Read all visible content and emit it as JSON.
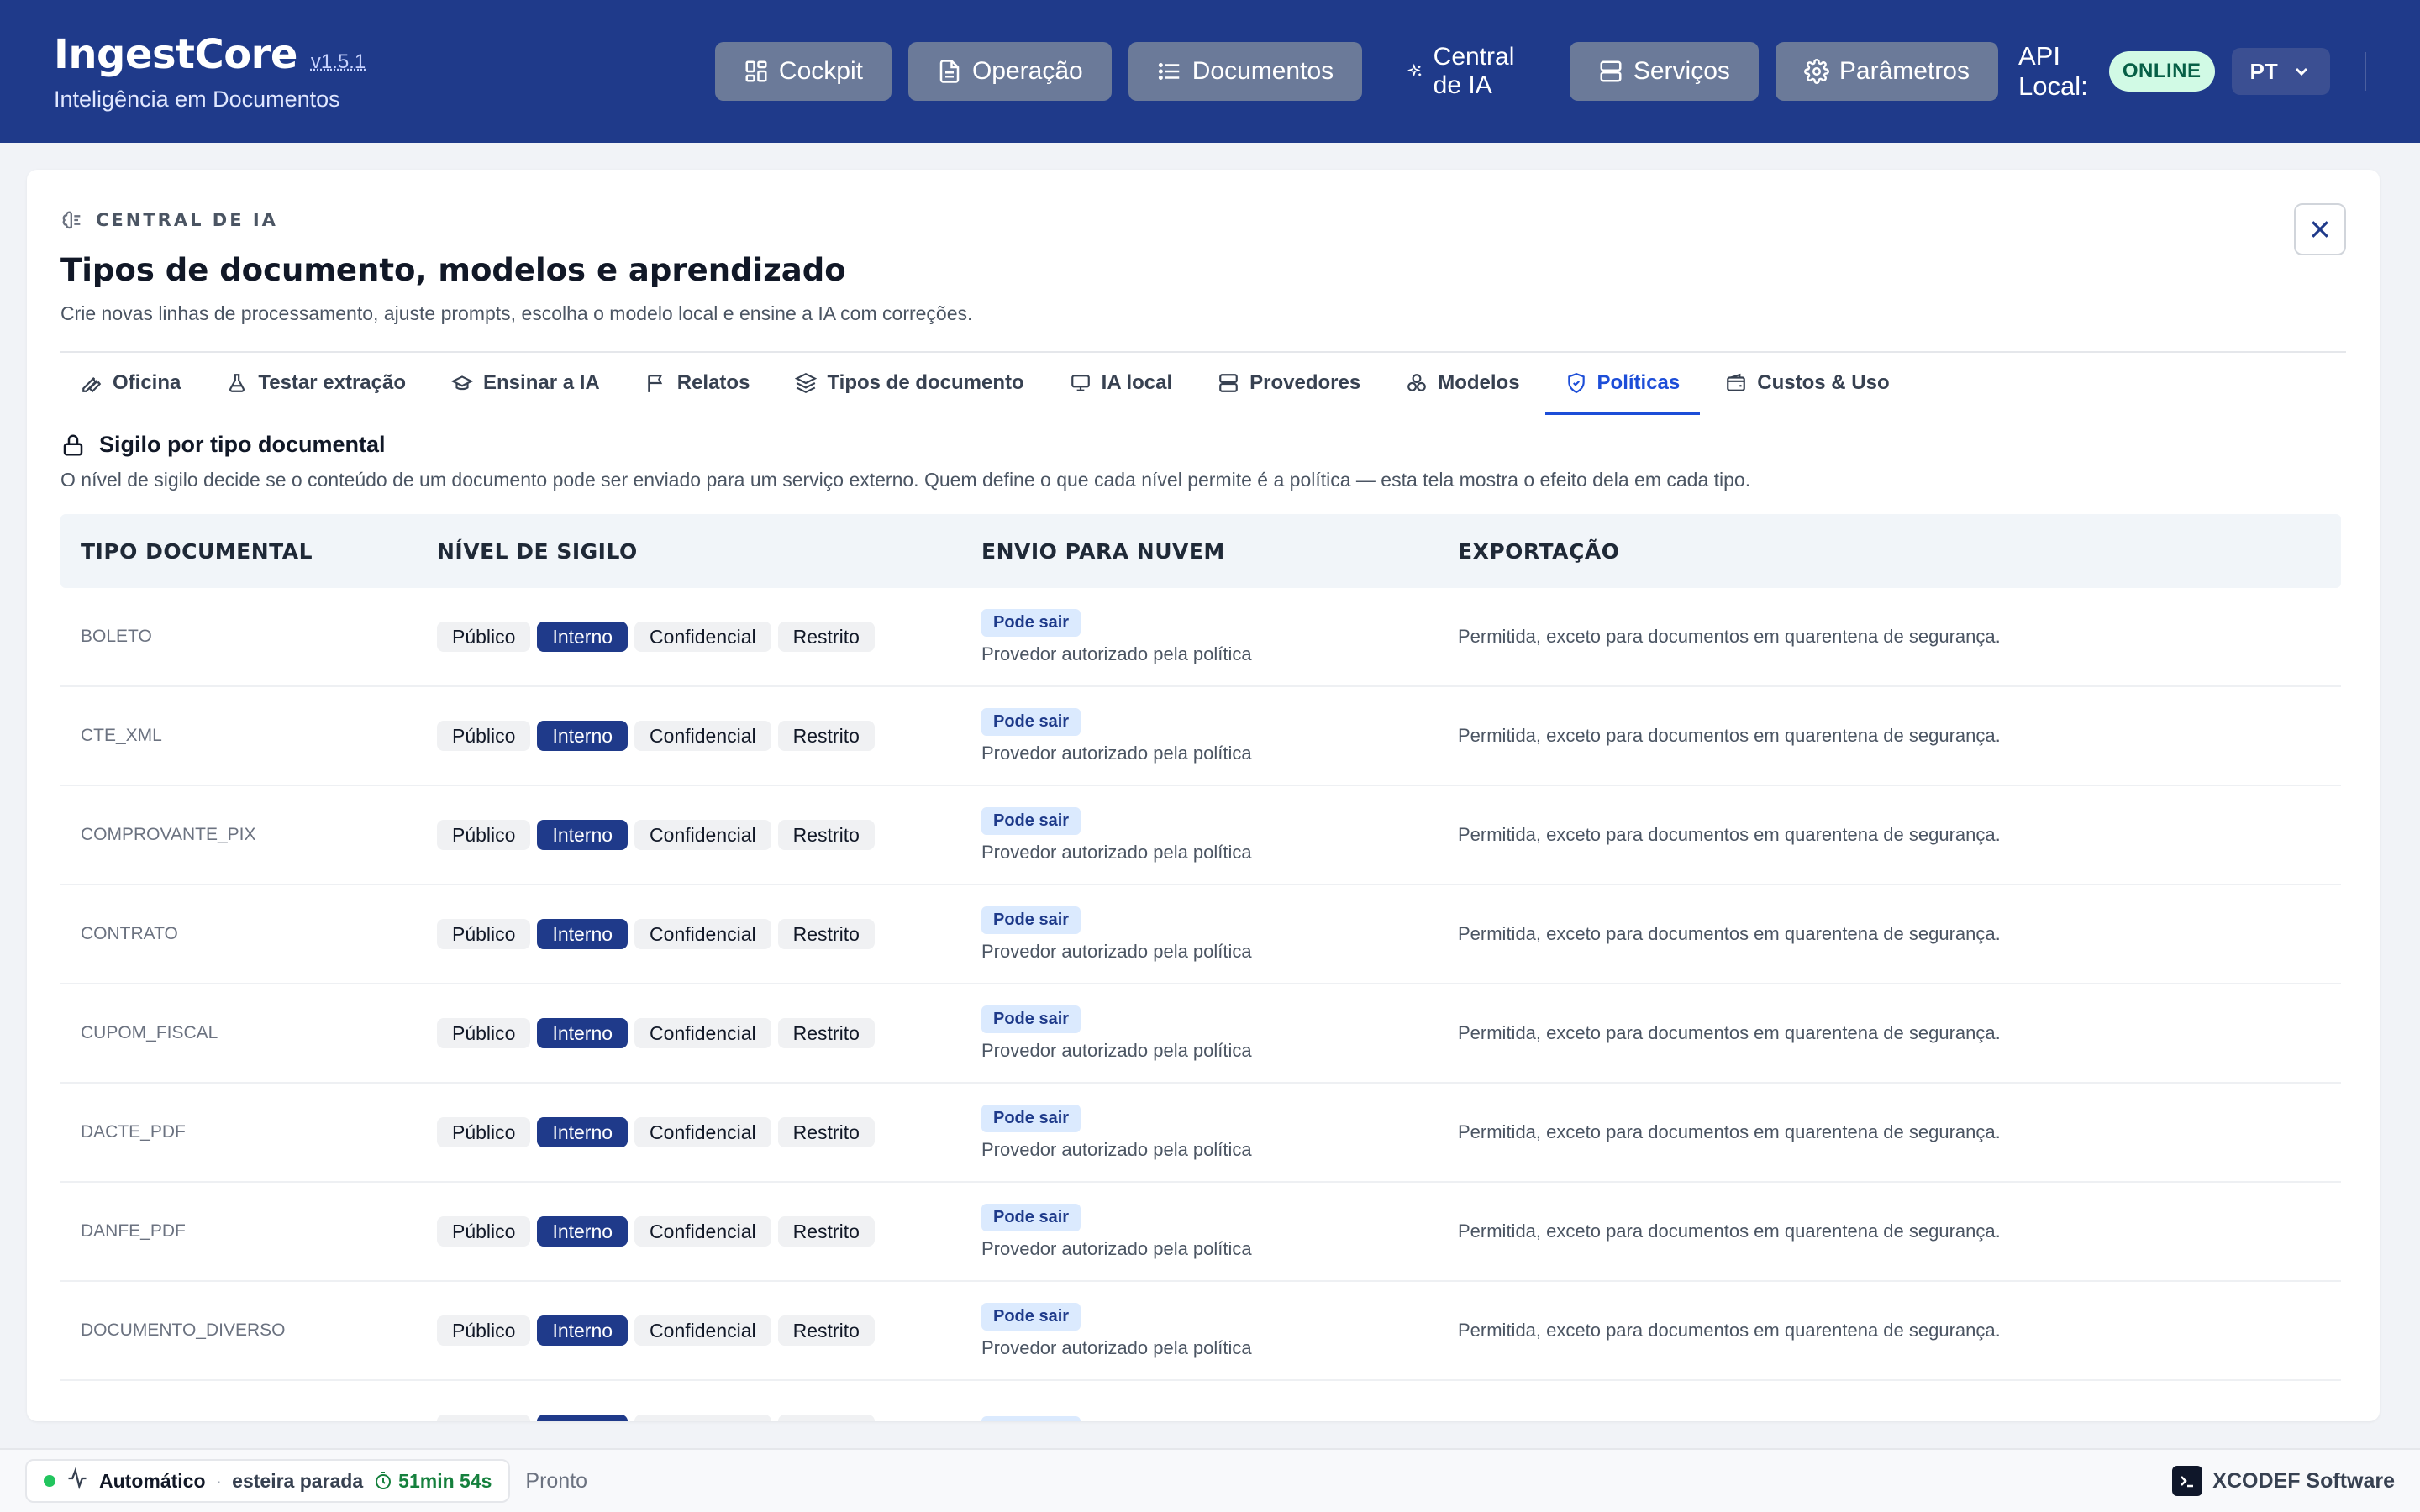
{
  "app": {
    "name": "IngestCore",
    "version": "v1.5.1",
    "subtitle": "Inteligência em Documentos"
  },
  "nav": [
    {
      "label": "Cockpit",
      "icon": "grid-icon"
    },
    {
      "label": "Operação",
      "icon": "document-icon"
    },
    {
      "label": "Documentos",
      "icon": "list-icon"
    },
    {
      "label": "Central de IA",
      "icon": "sparkles-icon"
    },
    {
      "label": "Serviços",
      "icon": "server-icon"
    },
    {
      "label": "Parâmetros",
      "icon": "gear-icon"
    }
  ],
  "api": {
    "label": "API Local:",
    "status": "ONLINE"
  },
  "language": {
    "selected": "PT"
  },
  "panel": {
    "eyebrow": "CENTRAL DE IA",
    "title": "Tipos de documento, modelos e aprendizado",
    "description": "Crie novas linhas de processamento, ajuste prompts, escolha o modelo local e ensine a IA com correções."
  },
  "tabs": [
    {
      "label": "Oficina",
      "icon": "wrench-icon"
    },
    {
      "label": "Testar extração",
      "icon": "flask-icon"
    },
    {
      "label": "Ensinar a IA",
      "icon": "graduation-cap-icon"
    },
    {
      "label": "Relatos",
      "icon": "flag-icon"
    },
    {
      "label": "Tipos de documento",
      "icon": "layers-icon"
    },
    {
      "label": "IA local",
      "icon": "monitor-icon"
    },
    {
      "label": "Provedores",
      "icon": "server-icon"
    },
    {
      "label": "Modelos",
      "icon": "boxes-icon"
    },
    {
      "label": "Políticas",
      "icon": "shield-icon"
    },
    {
      "label": "Custos & Uso",
      "icon": "wallet-icon"
    }
  ],
  "active_tab": "Políticas",
  "section": {
    "title": "Sigilo por tipo documental",
    "description": "O nível de sigilo decide se o conteúdo de um documento pode ser enviado para um serviço externo. Quem define o que cada nível permite é a política — esta tela mostra o efeito dela em cada tipo."
  },
  "table": {
    "headers": [
      "TIPO DOCUMENTAL",
      "NÍVEL DE SIGILO",
      "ENVIO PARA NUVEM",
      "EXPORTAÇÃO"
    ],
    "levels": [
      "Público",
      "Interno",
      "Confidencial",
      "Restrito"
    ],
    "rows": [
      {
        "type": "BOLETO",
        "level": "Interno",
        "cloud_badge": "Pode sair",
        "cloud_detail": "Provedor autorizado pela política",
        "export": "Permitida, exceto para documentos em quarentena de segurança."
      },
      {
        "type": "CTE_XML",
        "level": "Interno",
        "cloud_badge": "Pode sair",
        "cloud_detail": "Provedor autorizado pela política",
        "export": "Permitida, exceto para documentos em quarentena de segurança."
      },
      {
        "type": "COMPROVANTE_PIX",
        "level": "Interno",
        "cloud_badge": "Pode sair",
        "cloud_detail": "Provedor autorizado pela política",
        "export": "Permitida, exceto para documentos em quarentena de segurança."
      },
      {
        "type": "CONTRATO",
        "level": "Interno",
        "cloud_badge": "Pode sair",
        "cloud_detail": "Provedor autorizado pela política",
        "export": "Permitida, exceto para documentos em quarentena de segurança."
      },
      {
        "type": "CUPOM_FISCAL",
        "level": "Interno",
        "cloud_badge": "Pode sair",
        "cloud_detail": "Provedor autorizado pela política",
        "export": "Permitida, exceto para documentos em quarentena de segurança."
      },
      {
        "type": "DACTE_PDF",
        "level": "Interno",
        "cloud_badge": "Pode sair",
        "cloud_detail": "Provedor autorizado pela política",
        "export": "Permitida, exceto para documentos em quarentena de segurança."
      },
      {
        "type": "DANFE_PDF",
        "level": "Interno",
        "cloud_badge": "Pode sair",
        "cloud_detail": "Provedor autorizado pela política",
        "export": "Permitida, exceto para documentos em quarentena de segurança."
      },
      {
        "type": "DOCUMENTO_DIVERSO",
        "level": "Interno",
        "cloud_badge": "Pode sair",
        "cloud_detail": "Provedor autorizado pela política",
        "export": "Permitida, exceto para documentos em quarentena de segurança."
      },
      {
        "type": "",
        "level": "Interno",
        "cloud_badge": "Pode sair",
        "cloud_detail": "",
        "export": ""
      }
    ]
  },
  "footer": {
    "mode": "Automático",
    "separator": "·",
    "pipeline": "esteira parada",
    "timer": "51min 54s",
    "status": "Pronto",
    "vendor": "XCODEF Software"
  },
  "colors": {
    "header_bg": "#1f3a8a",
    "accent": "#1d4ed8",
    "selected_pill": "#1f3a8a",
    "online_bg": "#d1fae5",
    "online_text": "#065f46",
    "badge_bg": "#dbeafe",
    "status_dot": "#22c55e"
  }
}
